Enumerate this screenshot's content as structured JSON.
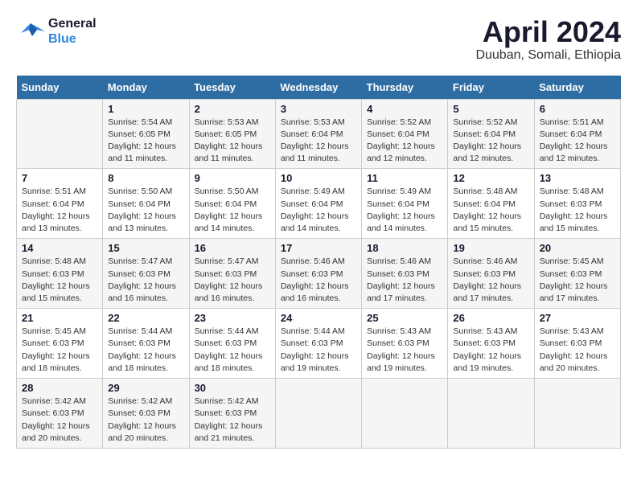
{
  "header": {
    "logo_line1": "General",
    "logo_line2": "Blue",
    "month": "April 2024",
    "location": "Duuban, Somali, Ethiopia"
  },
  "weekdays": [
    "Sunday",
    "Monday",
    "Tuesday",
    "Wednesday",
    "Thursday",
    "Friday",
    "Saturday"
  ],
  "weeks": [
    [
      {
        "day": "",
        "info": ""
      },
      {
        "day": "1",
        "info": "Sunrise: 5:54 AM\nSunset: 6:05 PM\nDaylight: 12 hours\nand 11 minutes."
      },
      {
        "day": "2",
        "info": "Sunrise: 5:53 AM\nSunset: 6:05 PM\nDaylight: 12 hours\nand 11 minutes."
      },
      {
        "day": "3",
        "info": "Sunrise: 5:53 AM\nSunset: 6:04 PM\nDaylight: 12 hours\nand 11 minutes."
      },
      {
        "day": "4",
        "info": "Sunrise: 5:52 AM\nSunset: 6:04 PM\nDaylight: 12 hours\nand 12 minutes."
      },
      {
        "day": "5",
        "info": "Sunrise: 5:52 AM\nSunset: 6:04 PM\nDaylight: 12 hours\nand 12 minutes."
      },
      {
        "day": "6",
        "info": "Sunrise: 5:51 AM\nSunset: 6:04 PM\nDaylight: 12 hours\nand 12 minutes."
      }
    ],
    [
      {
        "day": "7",
        "info": "Sunrise: 5:51 AM\nSunset: 6:04 PM\nDaylight: 12 hours\nand 13 minutes."
      },
      {
        "day": "8",
        "info": "Sunrise: 5:50 AM\nSunset: 6:04 PM\nDaylight: 12 hours\nand 13 minutes."
      },
      {
        "day": "9",
        "info": "Sunrise: 5:50 AM\nSunset: 6:04 PM\nDaylight: 12 hours\nand 14 minutes."
      },
      {
        "day": "10",
        "info": "Sunrise: 5:49 AM\nSunset: 6:04 PM\nDaylight: 12 hours\nand 14 minutes."
      },
      {
        "day": "11",
        "info": "Sunrise: 5:49 AM\nSunset: 6:04 PM\nDaylight: 12 hours\nand 14 minutes."
      },
      {
        "day": "12",
        "info": "Sunrise: 5:48 AM\nSunset: 6:04 PM\nDaylight: 12 hours\nand 15 minutes."
      },
      {
        "day": "13",
        "info": "Sunrise: 5:48 AM\nSunset: 6:03 PM\nDaylight: 12 hours\nand 15 minutes."
      }
    ],
    [
      {
        "day": "14",
        "info": "Sunrise: 5:48 AM\nSunset: 6:03 PM\nDaylight: 12 hours\nand 15 minutes."
      },
      {
        "day": "15",
        "info": "Sunrise: 5:47 AM\nSunset: 6:03 PM\nDaylight: 12 hours\nand 16 minutes."
      },
      {
        "day": "16",
        "info": "Sunrise: 5:47 AM\nSunset: 6:03 PM\nDaylight: 12 hours\nand 16 minutes."
      },
      {
        "day": "17",
        "info": "Sunrise: 5:46 AM\nSunset: 6:03 PM\nDaylight: 12 hours\nand 16 minutes."
      },
      {
        "day": "18",
        "info": "Sunrise: 5:46 AM\nSunset: 6:03 PM\nDaylight: 12 hours\nand 17 minutes."
      },
      {
        "day": "19",
        "info": "Sunrise: 5:46 AM\nSunset: 6:03 PM\nDaylight: 12 hours\nand 17 minutes."
      },
      {
        "day": "20",
        "info": "Sunrise: 5:45 AM\nSunset: 6:03 PM\nDaylight: 12 hours\nand 17 minutes."
      }
    ],
    [
      {
        "day": "21",
        "info": "Sunrise: 5:45 AM\nSunset: 6:03 PM\nDaylight: 12 hours\nand 18 minutes."
      },
      {
        "day": "22",
        "info": "Sunrise: 5:44 AM\nSunset: 6:03 PM\nDaylight: 12 hours\nand 18 minutes."
      },
      {
        "day": "23",
        "info": "Sunrise: 5:44 AM\nSunset: 6:03 PM\nDaylight: 12 hours\nand 18 minutes."
      },
      {
        "day": "24",
        "info": "Sunrise: 5:44 AM\nSunset: 6:03 PM\nDaylight: 12 hours\nand 19 minutes."
      },
      {
        "day": "25",
        "info": "Sunrise: 5:43 AM\nSunset: 6:03 PM\nDaylight: 12 hours\nand 19 minutes."
      },
      {
        "day": "26",
        "info": "Sunrise: 5:43 AM\nSunset: 6:03 PM\nDaylight: 12 hours\nand 19 minutes."
      },
      {
        "day": "27",
        "info": "Sunrise: 5:43 AM\nSunset: 6:03 PM\nDaylight: 12 hours\nand 20 minutes."
      }
    ],
    [
      {
        "day": "28",
        "info": "Sunrise: 5:42 AM\nSunset: 6:03 PM\nDaylight: 12 hours\nand 20 minutes."
      },
      {
        "day": "29",
        "info": "Sunrise: 5:42 AM\nSunset: 6:03 PM\nDaylight: 12 hours\nand 20 minutes."
      },
      {
        "day": "30",
        "info": "Sunrise: 5:42 AM\nSunset: 6:03 PM\nDaylight: 12 hours\nand 21 minutes."
      },
      {
        "day": "",
        "info": ""
      },
      {
        "day": "",
        "info": ""
      },
      {
        "day": "",
        "info": ""
      },
      {
        "day": "",
        "info": ""
      }
    ]
  ]
}
